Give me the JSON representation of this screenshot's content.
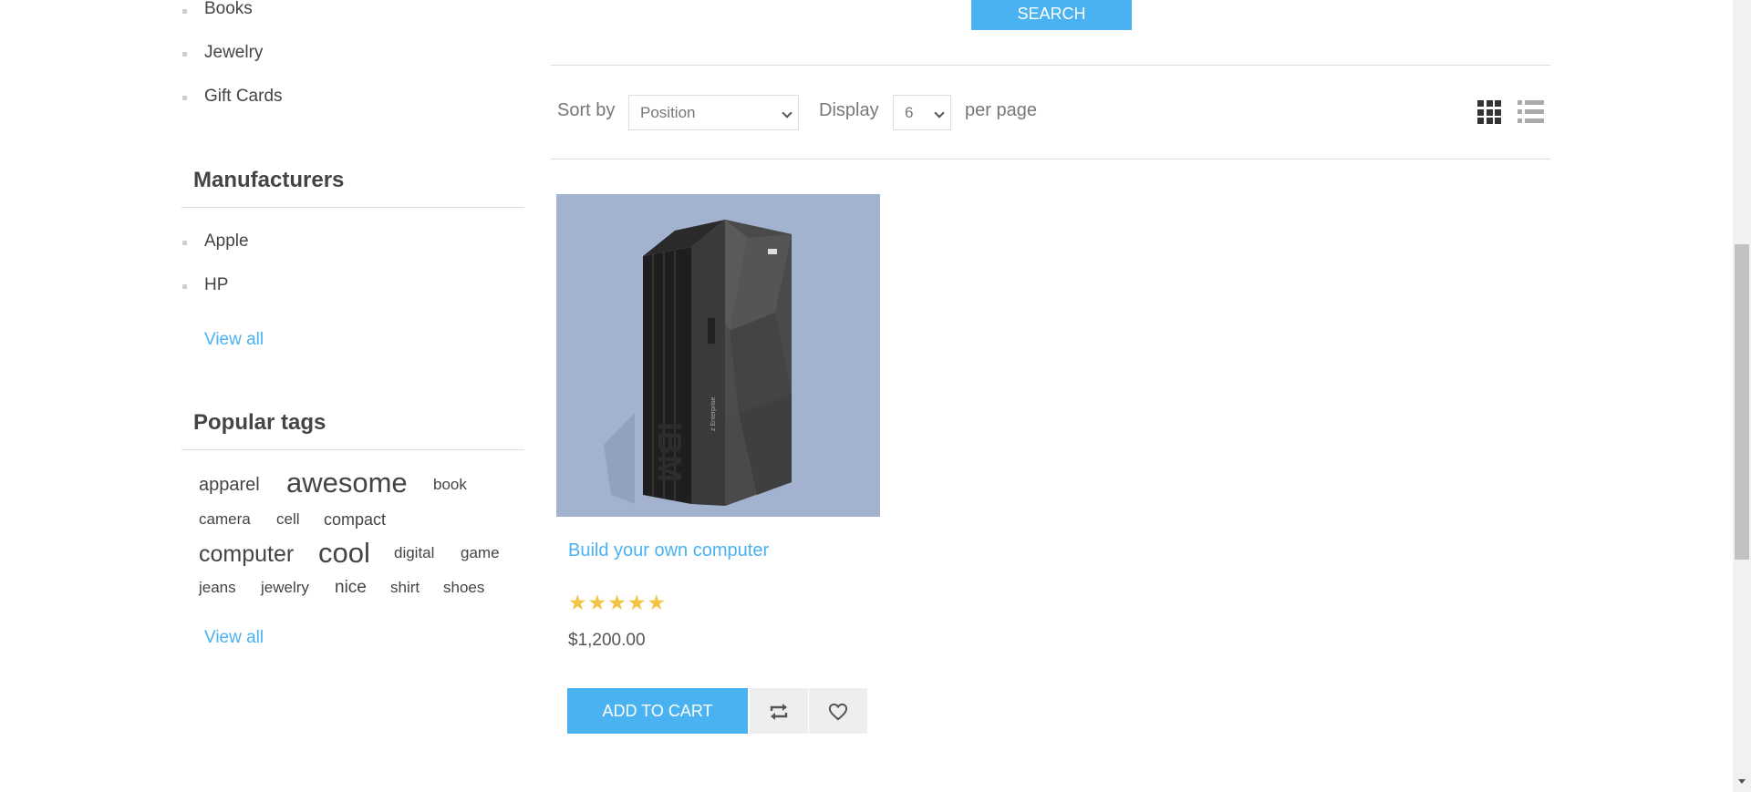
{
  "categories": [
    {
      "label": "Books"
    },
    {
      "label": "Jewelry"
    },
    {
      "label": "Gift Cards"
    }
  ],
  "manufacturers": {
    "title": "Manufacturers",
    "items": [
      {
        "label": "Apple"
      },
      {
        "label": "HP"
      }
    ],
    "view_all": "View all"
  },
  "popular_tags": {
    "title": "Popular tags",
    "tags": [
      "apparel",
      "awesome",
      "book",
      "camera",
      "cell",
      "compact",
      "computer",
      "cool",
      "digital",
      "game",
      "jeans",
      "jewelry",
      "nice",
      "shirt",
      "shoes"
    ],
    "view_all": "View all"
  },
  "search": {
    "button_label": "SEARCH"
  },
  "toolbar": {
    "sort_label": "Sort by",
    "sort_value": "Position",
    "display_label": "Display",
    "display_value": "6",
    "per_page_label": "per page",
    "grid_icon": "grid-view-icon",
    "list_icon": "list-view-icon"
  },
  "product": {
    "title": "Build your own computer",
    "rating_stars": 5,
    "rating_max": 5,
    "price": "$1,200.00",
    "add_to_cart": "ADD TO CART",
    "compare_icon": "compare-icon",
    "wishlist_icon": "heart-icon",
    "image_logo_text": "IBM",
    "image_side_text": "z Enterprise"
  },
  "colors": {
    "accent": "#4ab2f1",
    "star": "#f2c443",
    "product_bg": "#a3b3cf"
  }
}
